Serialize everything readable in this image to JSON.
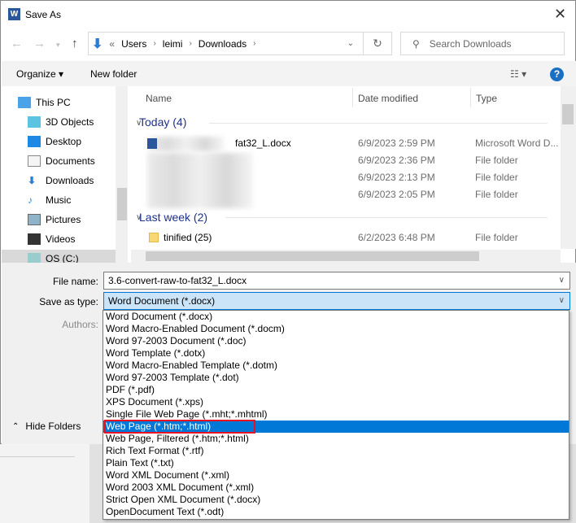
{
  "window": {
    "title": "Save As",
    "close": "✕"
  },
  "address": {
    "segments": [
      "«",
      "Users",
      "leimi",
      "Downloads"
    ],
    "search_placeholder": "Search Downloads"
  },
  "toolbar": {
    "organize": "Organize ▾",
    "new_folder": "New folder",
    "view": "☷ ▾",
    "help": "?"
  },
  "nav": {
    "items": [
      {
        "label": "This PC",
        "icon": "pc-icon"
      },
      {
        "label": "3D Objects",
        "icon": "cube-icon"
      },
      {
        "label": "Desktop",
        "icon": "desktop-icon"
      },
      {
        "label": "Documents",
        "icon": "documents-icon"
      },
      {
        "label": "Downloads",
        "icon": "download-icon"
      },
      {
        "label": "Music",
        "icon": "music-icon"
      },
      {
        "label": "Pictures",
        "icon": "pictures-icon"
      },
      {
        "label": "Videos",
        "icon": "videos-icon"
      },
      {
        "label": "OS (C:)",
        "icon": "drive-icon"
      }
    ]
  },
  "columns": {
    "name": "Name",
    "date": "Date modified",
    "type": "Type"
  },
  "groups": [
    {
      "label": "Today (4)",
      "files": [
        {
          "name": "fat32_L.docx",
          "date": "6/9/2023 2:59 PM",
          "type": "Microsoft Word D..."
        },
        {
          "name": "",
          "date": "6/9/2023 2:36 PM",
          "type": "File folder"
        },
        {
          "name": "",
          "date": "6/9/2023 2:13 PM",
          "type": "File folder"
        },
        {
          "name": "",
          "date": "6/9/2023 2:05 PM",
          "type": "File folder"
        }
      ]
    },
    {
      "label": "Last week (2)",
      "files": [
        {
          "name": "tinified (25)",
          "date": "6/2/2023 6:48 PM",
          "type": "File folder"
        }
      ]
    }
  ],
  "form": {
    "file_name_label": "File name:",
    "file_name": "3.6-convert-raw-to-fat32_L.docx",
    "type_label": "Save as type:",
    "type_value": "Word Document (*.docx)",
    "authors_label": "Authors:"
  },
  "type_options": [
    "Word Document (*.docx)",
    "Word Macro-Enabled Document (*.docm)",
    "Word 97-2003 Document (*.doc)",
    "Word Template (*.dotx)",
    "Word Macro-Enabled Template (*.dotm)",
    "Word 97-2003 Template (*.dot)",
    "PDF (*.pdf)",
    "XPS Document (*.xps)",
    "Single File Web Page (*.mht;*.mhtml)",
    "Web Page (*.htm;*.html)",
    "Web Page, Filtered (*.htm;*.html)",
    "Rich Text Format (*.rtf)",
    "Plain Text (*.txt)",
    "Word XML Document (*.xml)",
    "Word 2003 XML Document (*.xml)",
    "Strict Open XML Document (*.docx)",
    "OpenDocument Text (*.odt)"
  ],
  "highlighted_option": "Web Page (*.htm;*.html)",
  "hide_folders": "Hide Folders",
  "colors": {
    "accent": "#0078d7",
    "highlight_border": "#e81123",
    "group_text": "#1e3287"
  }
}
